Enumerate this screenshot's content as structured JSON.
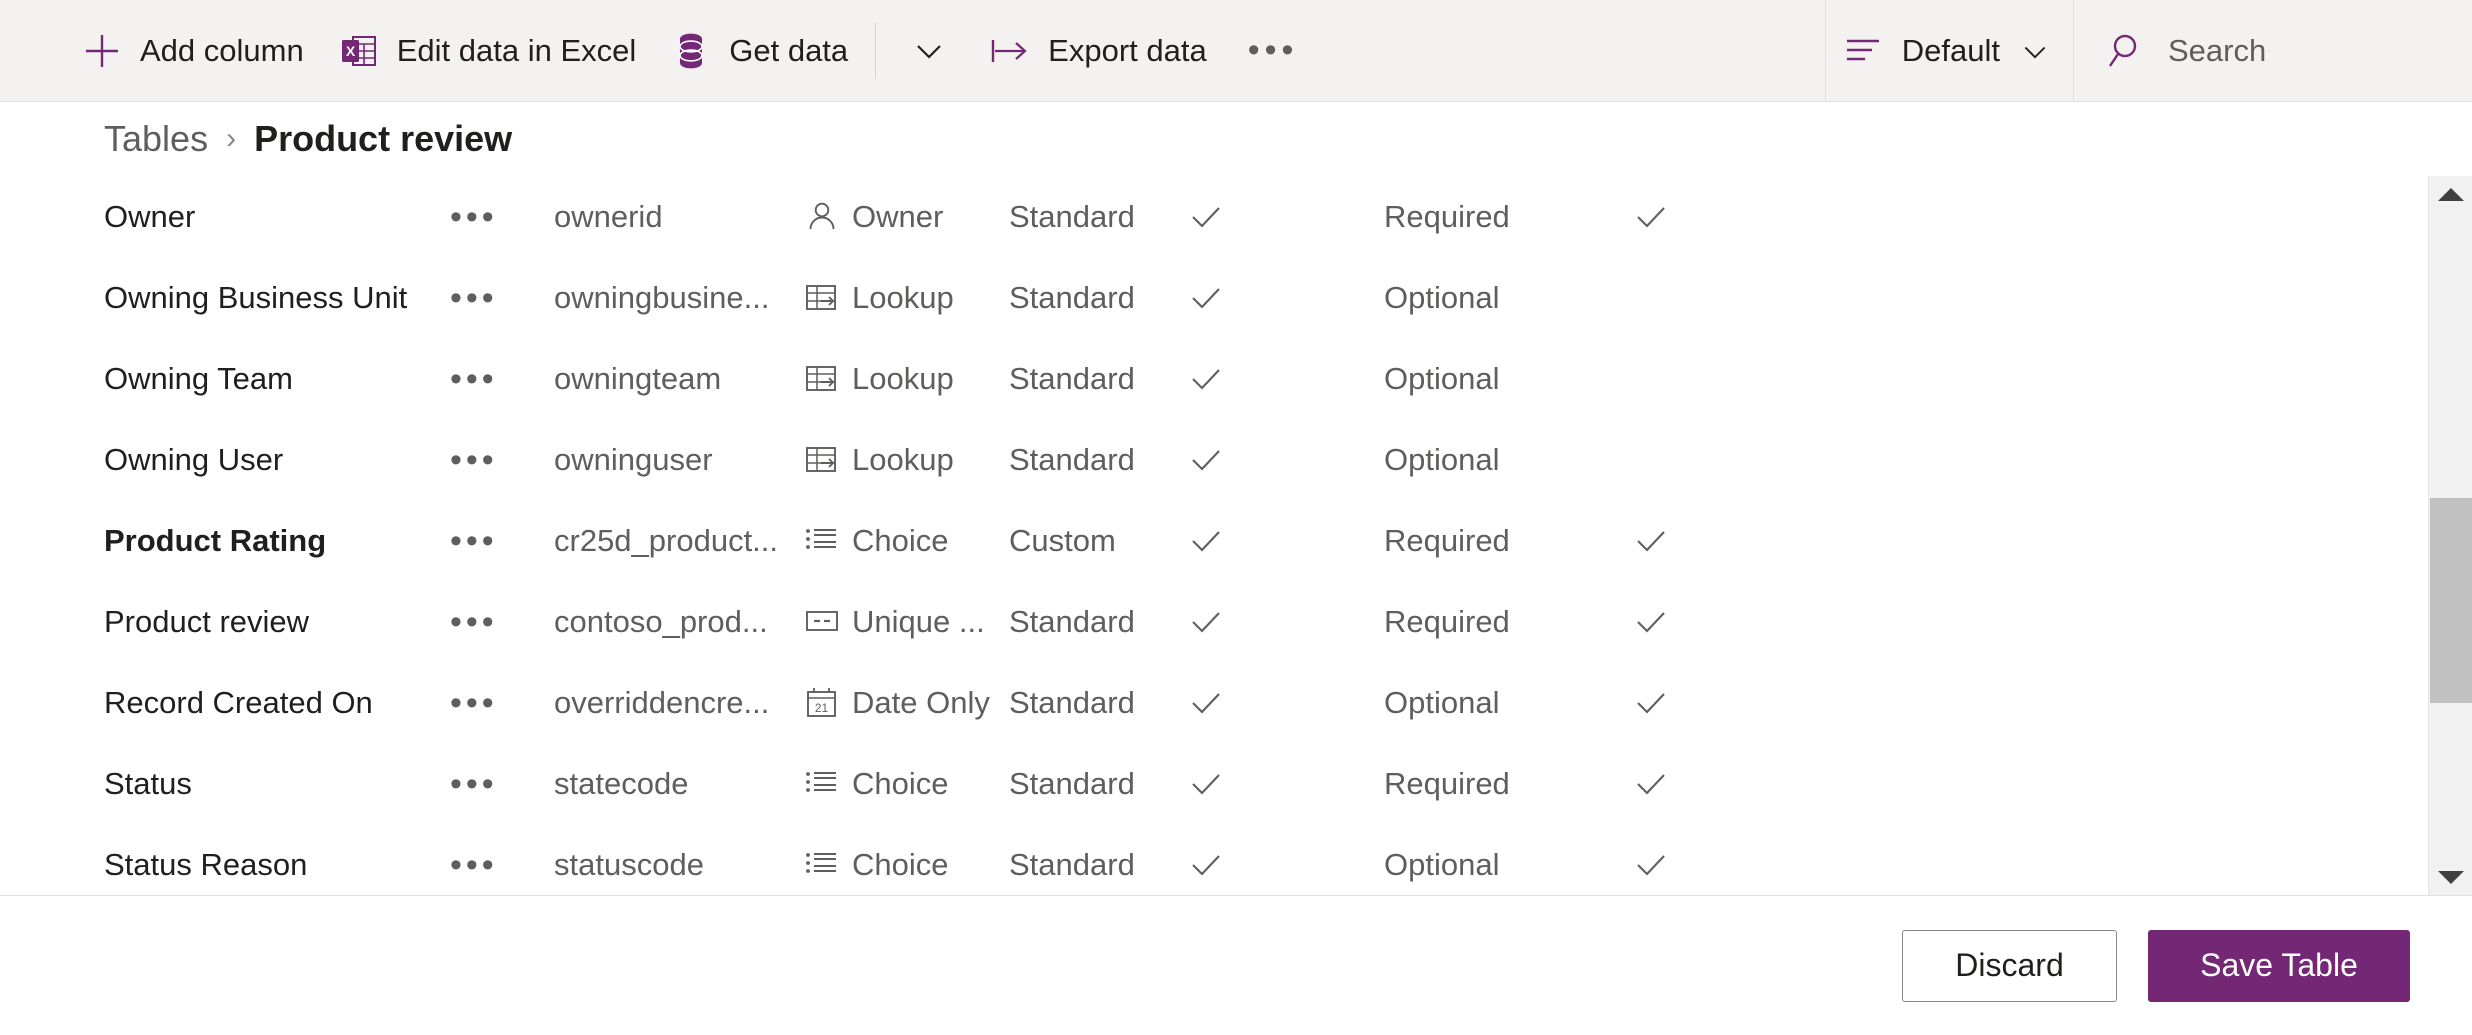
{
  "commandbar": {
    "items": [
      {
        "label": "Add column",
        "icon": "plus-icon"
      },
      {
        "label": "Edit data in Excel",
        "icon": "excel-icon"
      },
      {
        "label": "Get data",
        "icon": "database-icon"
      },
      {
        "label": "Export data",
        "icon": "export-icon"
      }
    ],
    "get_data_caret": "chevron-down-icon",
    "overflow_label": "•••",
    "view_label": "Default",
    "view_icon": "view-list-icon",
    "view_caret": "chevron-down-icon",
    "search_placeholder": "Search",
    "search_icon": "search-icon"
  },
  "breadcrumb": {
    "parent": "Tables",
    "separator": "›",
    "current": "Product review"
  },
  "grid": {
    "rows": [
      {
        "display_name": "Owner",
        "menu": "•••",
        "name": "ownerid",
        "data_type": "Owner",
        "type_icon": "person-icon",
        "type_origin": "Standard",
        "customizable": true,
        "requirement": "Required",
        "searchable": true,
        "modified": false
      },
      {
        "display_name": "Owning Business Unit",
        "menu": "•••",
        "name": "owningbusine...",
        "data_type": "Lookup",
        "type_icon": "lookup-icon",
        "type_origin": "Standard",
        "customizable": true,
        "requirement": "Optional",
        "searchable": false,
        "modified": false
      },
      {
        "display_name": "Owning Team",
        "menu": "•••",
        "name": "owningteam",
        "data_type": "Lookup",
        "type_icon": "lookup-icon",
        "type_origin": "Standard",
        "customizable": true,
        "requirement": "Optional",
        "searchable": false,
        "modified": false
      },
      {
        "display_name": "Owning User",
        "menu": "•••",
        "name": "owninguser",
        "data_type": "Lookup",
        "type_icon": "lookup-icon",
        "type_origin": "Standard",
        "customizable": true,
        "requirement": "Optional",
        "searchable": false,
        "modified": false
      },
      {
        "display_name": "Product Rating",
        "menu": "•••",
        "name": "cr25d_product...",
        "data_type": "Choice",
        "type_icon": "choice-icon",
        "type_origin": "Custom",
        "customizable": true,
        "requirement": "Required",
        "searchable": true,
        "modified": true
      },
      {
        "display_name": "Product review",
        "menu": "•••",
        "name": "contoso_prod...",
        "data_type": "Unique ...",
        "type_icon": "unique-id-icon",
        "type_origin": "Standard",
        "customizable": true,
        "requirement": "Required",
        "searchable": true,
        "modified": false
      },
      {
        "display_name": "Record Created On",
        "menu": "•••",
        "name": "overriddencre...",
        "data_type": "Date Only",
        "type_icon": "calendar-icon",
        "type_origin": "Standard",
        "customizable": true,
        "requirement": "Optional",
        "searchable": true,
        "modified": false
      },
      {
        "display_name": "Status",
        "menu": "•••",
        "name": "statecode",
        "data_type": "Choice",
        "type_icon": "choice-icon",
        "type_origin": "Standard",
        "customizable": true,
        "requirement": "Required",
        "searchable": true,
        "modified": false
      },
      {
        "display_name": "Status Reason",
        "menu": "•••",
        "name": "statuscode",
        "data_type": "Choice",
        "type_icon": "choice-icon",
        "type_origin": "Standard",
        "customizable": true,
        "requirement": "Optional",
        "searchable": true,
        "modified": false
      }
    ]
  },
  "footer": {
    "discard_label": "Discard",
    "save_label": "Save Table"
  },
  "colors": {
    "accent": "#742774",
    "commandbar_bg": "#f3f2f1",
    "text_primary": "#201f1e",
    "text_secondary": "#605e5c"
  }
}
